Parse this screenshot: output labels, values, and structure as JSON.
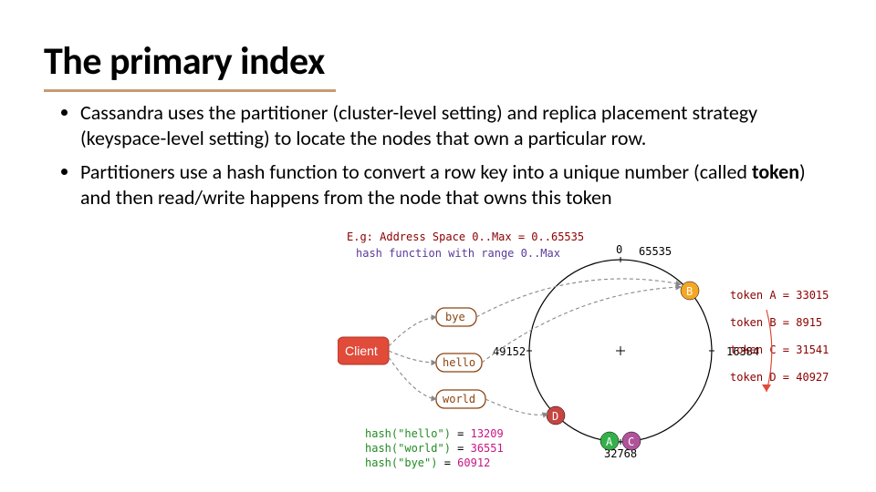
{
  "title": "The primary index",
  "bullets": [
    "Cassandra uses the partitioner (cluster-level setting) and replica placement strategy (keyspace-level setting) to locate the nodes that own a particular row.",
    "Partitioners use a hash function to convert a row key into a unique number (called <b>token</b>) and then read/write happens from the node that owns this token"
  ],
  "diagram": {
    "header_eg": "E.g: Address Space 0..Max = 0..65535",
    "header_hash": "hash function with range 0..Max",
    "ring_labels": {
      "top": "0",
      "top_right": "65535",
      "right_outer": "16384",
      "bottom": "32768",
      "left": "49152"
    },
    "tokens": [
      "token A = 33015",
      "token B =  8915",
      "token C = 31541",
      "token D = 40927"
    ],
    "client_label": "Client",
    "keys": [
      "bye",
      "hello",
      "world"
    ],
    "hashes": [
      {
        "fn": "hash(\"hello\")",
        "val": "13209"
      },
      {
        "fn": "hash(\"world\")",
        "val": "36551"
      },
      {
        "fn": "hash(\"bye\")",
        "val": "60912"
      }
    ],
    "nodes": {
      "A": {
        "color": "#34B04A",
        "label": "A"
      },
      "B": {
        "color": "#F5A623",
        "label": "B"
      },
      "C": {
        "color": "#B0539B",
        "label": "C"
      },
      "D": {
        "color": "#C74440",
        "label": "D"
      }
    }
  }
}
